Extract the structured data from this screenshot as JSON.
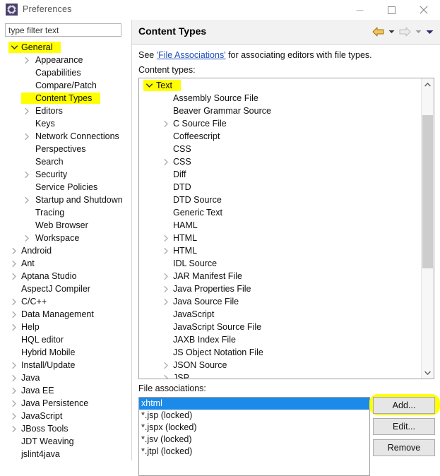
{
  "window": {
    "title": "Preferences",
    "icon": "gear-icon",
    "controls": {
      "minimize": "minimize-icon",
      "maximize": "maximize-icon",
      "close": "close-icon"
    }
  },
  "filter": {
    "placeholder": "type filter text",
    "value": ""
  },
  "sidebar": {
    "items": [
      {
        "label": "General",
        "level": 1,
        "twisty": "chevron-down",
        "highlight": true
      },
      {
        "label": "Appearance",
        "level": 2,
        "twisty": "chevron-right"
      },
      {
        "label": "Capabilities",
        "level": 2,
        "twisty": "none"
      },
      {
        "label": "Compare/Patch",
        "level": 2,
        "twisty": "none"
      },
      {
        "label": "Content Types",
        "level": 2,
        "twisty": "none",
        "highlight": true,
        "selected": true
      },
      {
        "label": "Editors",
        "level": 2,
        "twisty": "chevron-right"
      },
      {
        "label": "Keys",
        "level": 2,
        "twisty": "none"
      },
      {
        "label": "Network Connections",
        "level": 2,
        "twisty": "chevron-right"
      },
      {
        "label": "Perspectives",
        "level": 2,
        "twisty": "none"
      },
      {
        "label": "Search",
        "level": 2,
        "twisty": "none"
      },
      {
        "label": "Security",
        "level": 2,
        "twisty": "chevron-right"
      },
      {
        "label": "Service Policies",
        "level": 2,
        "twisty": "none"
      },
      {
        "label": "Startup and Shutdown",
        "level": 2,
        "twisty": "chevron-right"
      },
      {
        "label": "Tracing",
        "level": 2,
        "twisty": "none"
      },
      {
        "label": "Web Browser",
        "level": 2,
        "twisty": "none"
      },
      {
        "label": "Workspace",
        "level": 2,
        "twisty": "chevron-right"
      },
      {
        "label": "Android",
        "level": 1,
        "twisty": "chevron-right"
      },
      {
        "label": "Ant",
        "level": 1,
        "twisty": "chevron-right"
      },
      {
        "label": "Aptana Studio",
        "level": 1,
        "twisty": "chevron-right"
      },
      {
        "label": "AspectJ Compiler",
        "level": 1,
        "twisty": "none"
      },
      {
        "label": "C/C++",
        "level": 1,
        "twisty": "chevron-right"
      },
      {
        "label": "Data Management",
        "level": 1,
        "twisty": "chevron-right"
      },
      {
        "label": "Help",
        "level": 1,
        "twisty": "chevron-right"
      },
      {
        "label": "HQL editor",
        "level": 1,
        "twisty": "none"
      },
      {
        "label": "Hybrid Mobile",
        "level": 1,
        "twisty": "none"
      },
      {
        "label": "Install/Update",
        "level": 1,
        "twisty": "chevron-right"
      },
      {
        "label": "Java",
        "level": 1,
        "twisty": "chevron-right"
      },
      {
        "label": "Java EE",
        "level": 1,
        "twisty": "chevron-right"
      },
      {
        "label": "Java Persistence",
        "level": 1,
        "twisty": "chevron-right"
      },
      {
        "label": "JavaScript",
        "level": 1,
        "twisty": "chevron-right"
      },
      {
        "label": "JBoss Tools",
        "level": 1,
        "twisty": "chevron-right"
      },
      {
        "label": "JDT Weaving",
        "level": 1,
        "twisty": "none"
      },
      {
        "label": "jslint4java",
        "level": 1,
        "twisty": "none"
      }
    ]
  },
  "page": {
    "title": "Content Types",
    "nav": {
      "back": "back-arrow-icon",
      "back_menu": "chevron-down-icon",
      "forward": "forward-arrow-icon",
      "forward_menu": "chevron-down-icon",
      "menu": "chevron-down-icon"
    },
    "description": {
      "prefix": "See ",
      "link": "'File Associations'",
      "suffix": " for associating editors with file types."
    },
    "content_types_label": "Content types:",
    "content_types": [
      {
        "label": "Text",
        "level": 0,
        "twisty": "chevron-down",
        "highlight": true
      },
      {
        "label": "Assembly Source File",
        "level": 1,
        "twisty": "none"
      },
      {
        "label": "Beaver Grammar Source",
        "level": 1,
        "twisty": "none"
      },
      {
        "label": "C Source File",
        "level": 1,
        "twisty": "chevron-right"
      },
      {
        "label": "Coffeescript",
        "level": 1,
        "twisty": "none"
      },
      {
        "label": "CSS",
        "level": 1,
        "twisty": "none"
      },
      {
        "label": "CSS",
        "level": 1,
        "twisty": "chevron-right"
      },
      {
        "label": "Diff",
        "level": 1,
        "twisty": "none"
      },
      {
        "label": "DTD",
        "level": 1,
        "twisty": "none"
      },
      {
        "label": "DTD Source",
        "level": 1,
        "twisty": "none"
      },
      {
        "label": "Generic Text",
        "level": 1,
        "twisty": "none"
      },
      {
        "label": "HAML",
        "level": 1,
        "twisty": "none"
      },
      {
        "label": "HTML",
        "level": 1,
        "twisty": "chevron-right"
      },
      {
        "label": "HTML",
        "level": 1,
        "twisty": "chevron-right"
      },
      {
        "label": "IDL Source",
        "level": 1,
        "twisty": "none"
      },
      {
        "label": "JAR Manifest File",
        "level": 1,
        "twisty": "chevron-right"
      },
      {
        "label": "Java Properties File",
        "level": 1,
        "twisty": "chevron-right"
      },
      {
        "label": "Java Source File",
        "level": 1,
        "twisty": "chevron-right"
      },
      {
        "label": "JavaScript",
        "level": 1,
        "twisty": "none"
      },
      {
        "label": "JavaScript Source File",
        "level": 1,
        "twisty": "none"
      },
      {
        "label": "JAXB Index File",
        "level": 1,
        "twisty": "none"
      },
      {
        "label": "JS Object Notation File",
        "level": 1,
        "twisty": "none"
      },
      {
        "label": "JSON Source",
        "level": 1,
        "twisty": "chevron-right"
      },
      {
        "label": "JSP",
        "level": 1,
        "twisty": "chevron-right"
      }
    ],
    "scrollbar": {
      "up": "scroll-up-icon",
      "down": "scroll-down-icon"
    },
    "file_associations_label": "File associations:",
    "file_associations": [
      {
        "label": "xhtml",
        "selected": true
      },
      {
        "label": "*.jsp (locked)",
        "selected": false
      },
      {
        "label": "*.jspx (locked)",
        "selected": false
      },
      {
        "label": "*.jsv (locked)",
        "selected": false
      },
      {
        "label": "*.jtpl (locked)",
        "selected": false
      }
    ],
    "buttons": {
      "add": "Add...",
      "edit": "Edit...",
      "remove": "Remove"
    }
  },
  "colors": {
    "highlight_marker": "#ffff00",
    "selection_blue": "#1c8ae8",
    "link_blue": "#1f4fbf",
    "back_arrow": "#e8a92e",
    "forward_arrow": "#cfcfcf",
    "menu_caret": "#2b2b70"
  }
}
